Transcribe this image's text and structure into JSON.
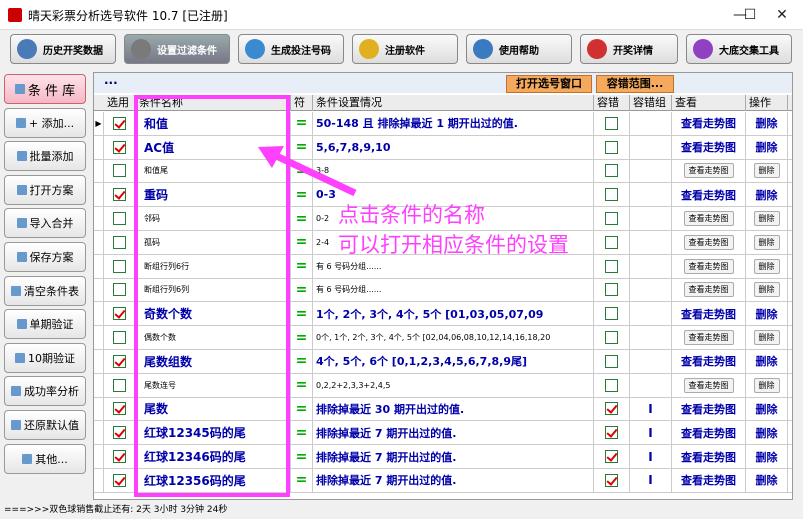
{
  "window": {
    "title": "晴天彩票分析选号软件 10.7 [已注册]",
    "minimize": "—",
    "maximize": "☐",
    "close": "✕"
  },
  "toolbar": [
    {
      "label": "历史开奖数据",
      "icon": "history-icon",
      "color": "#4a7bb7"
    },
    {
      "label": "设置过滤条件",
      "icon": "tools-icon",
      "color": "#7a7a7a",
      "active": true
    },
    {
      "label": "生成投注号码",
      "icon": "play-icon",
      "color": "#3a8ad0"
    },
    {
      "label": "注册软件",
      "icon": "key-icon",
      "color": "#e0b020"
    },
    {
      "label": "使用帮助",
      "icon": "help-icon",
      "color": "#3a7ac0"
    },
    {
      "label": "开奖详情",
      "icon": "info-icon",
      "color": "#d03030"
    },
    {
      "label": "大底交集工具",
      "icon": "cube-icon",
      "color": "#9040c0"
    }
  ],
  "sidebar": [
    {
      "label": "条 件 库",
      "style": "pink"
    },
    {
      "label": "+ 添加...",
      "style": "normal"
    },
    {
      "label": "批量添加",
      "style": "normal"
    },
    {
      "label": "打开方案",
      "style": "normal"
    },
    {
      "label": "导入合并",
      "style": "normal"
    },
    {
      "label": "保存方案",
      "style": "normal"
    },
    {
      "label": "清空条件表",
      "style": "normal"
    },
    {
      "label": "单期验证",
      "style": "normal"
    },
    {
      "label": "10期验证",
      "style": "normal"
    },
    {
      "label": "成功率分析",
      "style": "normal"
    },
    {
      "label": "还原默认值",
      "style": "normal"
    },
    {
      "label": "其他...",
      "style": "normal"
    }
  ],
  "topbar": {
    "dots": "...",
    "open_window": "打开选号窗口",
    "tolerance_range": "容错范围..."
  },
  "columns": [
    "选用",
    "条件名称",
    "符",
    "条件设置情况",
    "容错",
    "容错组",
    "查看",
    "操作"
  ],
  "rows": [
    {
      "checked": true,
      "name": "和值",
      "big": true,
      "sym": "=",
      "setting": "50-148 且 排除掉最近 1 期开出过的值.",
      "tol": false,
      "group": "",
      "view": "查看走势图",
      "op": "删除"
    },
    {
      "checked": true,
      "name": "AC值",
      "big": true,
      "sym": "=",
      "setting": "5,6,7,8,9,10",
      "tol": false,
      "group": "",
      "view": "查看走势图",
      "op": "删除"
    },
    {
      "checked": false,
      "name": "和值尾",
      "big": false,
      "sym": "=",
      "setting": "3-8",
      "tol": false,
      "group": "",
      "view": "查看走势图",
      "op": "删除"
    },
    {
      "checked": true,
      "name": "重码",
      "big": true,
      "sym": "=",
      "setting": "0-3",
      "tol": false,
      "group": "",
      "view": "查看走势图",
      "op": "删除"
    },
    {
      "checked": false,
      "name": "邻码",
      "big": false,
      "sym": "=",
      "setting": "0-2",
      "tol": false,
      "group": "",
      "view": "查看走势图",
      "op": "删除"
    },
    {
      "checked": false,
      "name": "孤码",
      "big": false,
      "sym": "=",
      "setting": "2-4",
      "tol": false,
      "group": "",
      "view": "查看走势图",
      "op": "删除"
    },
    {
      "checked": false,
      "name": "断组行列6行",
      "big": false,
      "sym": "=",
      "setting": "有 6 号码分组......",
      "tol": false,
      "group": "",
      "view": "查看走势图",
      "op": "删除"
    },
    {
      "checked": false,
      "name": "断组行列6列",
      "big": false,
      "sym": "=",
      "setting": "有 6 号码分组......",
      "tol": false,
      "group": "",
      "view": "查看走势图",
      "op": "删除"
    },
    {
      "checked": true,
      "name": "奇数个数",
      "big": true,
      "sym": "=",
      "setting": "1个, 2个, 3个, 4个, 5个   [01,03,05,07,09",
      "tol": false,
      "group": "",
      "view": "查看走势图",
      "op": "删除"
    },
    {
      "checked": false,
      "name": "偶数个数",
      "big": false,
      "sym": "=",
      "setting": "0个, 1个, 2个, 3个, 4个, 5个   [02,04,06,08,10,12,14,16,18,20",
      "tol": false,
      "group": "",
      "view": "查看走势图",
      "op": "删除"
    },
    {
      "checked": true,
      "name": "尾数组数",
      "big": true,
      "sym": "=",
      "setting": "4个, 5个, 6个   [0,1,2,3,4,5,6,7,8,9尾]",
      "tol": false,
      "group": "",
      "view": "查看走势图",
      "op": "删除"
    },
    {
      "checked": false,
      "name": "尾数连号",
      "big": false,
      "sym": "=",
      "setting": "0,2,2+2,3,3+2,4,5",
      "tol": false,
      "group": "",
      "view": "查看走势图",
      "op": "删除"
    },
    {
      "checked": true,
      "name": "尾数",
      "big": true,
      "sym": "=",
      "setting": "排除掉最近 30 期开出过的值.",
      "tol": true,
      "group": "I",
      "view": "查看走势图",
      "op": "删除"
    },
    {
      "checked": true,
      "name": "红球12345码的尾",
      "big": true,
      "sym": "=",
      "setting": "排除掉最近 7 期开出过的值.",
      "tol": true,
      "group": "I",
      "view": "查看走势图",
      "op": "删除"
    },
    {
      "checked": true,
      "name": "红球12346码的尾",
      "big": true,
      "sym": "=",
      "setting": "排除掉最近 7 期开出过的值.",
      "tol": true,
      "group": "I",
      "view": "查看走势图",
      "op": "删除"
    },
    {
      "checked": true,
      "name": "红球12356码的尾",
      "big": true,
      "sym": "=",
      "setting": "排除掉最近 7 期开出过的值.",
      "tol": true,
      "group": "I",
      "view": "查看走势图",
      "op": "删除"
    }
  ],
  "annotation": {
    "line1": "点击条件的名称",
    "line2": "可以打开相应条件的设置"
  },
  "status": "===>>>双色球销售截止还有: 2天 3小时 3分钟 24秒",
  "colors": {
    "highlight": "#ff40ff",
    "link": "#0000aa",
    "check": "#d00000"
  }
}
